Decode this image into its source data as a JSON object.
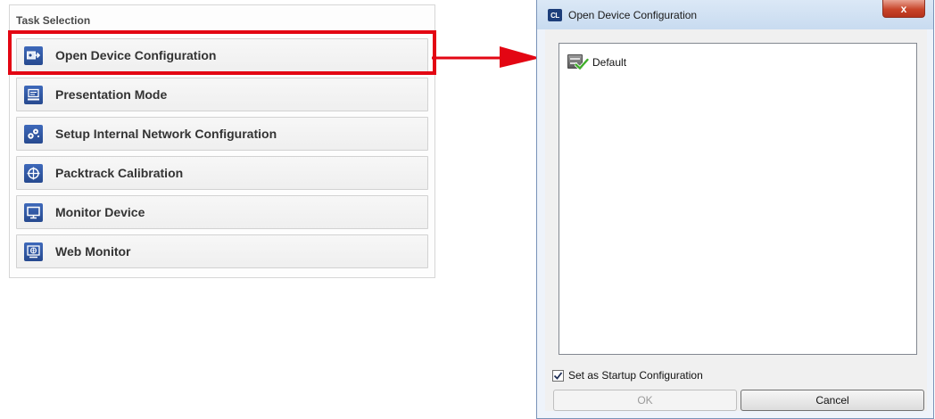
{
  "task_panel": {
    "title": "Task Selection",
    "items": [
      {
        "label": "Open Device Configuration",
        "icon": "open-configuration-icon"
      },
      {
        "label": "Presentation Mode",
        "icon": "presentation-mode-icon"
      },
      {
        "label": "Setup Internal Network Configuration",
        "icon": "network-configuration-icon"
      },
      {
        "label": "Packtrack Calibration",
        "icon": "calibration-crosshair-icon"
      },
      {
        "label": "Monitor Device",
        "icon": "monitor-icon"
      },
      {
        "label": "Web Monitor",
        "icon": "web-monitor-icon"
      }
    ],
    "highlighted_item": "Open Device Configuration",
    "highlight_color": "#e30613"
  },
  "dialog": {
    "app_icon_text": "CL",
    "title": "Open Device Configuration",
    "close_label": "x",
    "configurations": [
      {
        "name": "Default",
        "icon": "configuration-check-icon"
      }
    ],
    "startup_checkbox": {
      "label": "Set as Startup Configuration",
      "checked": true
    },
    "ok_label": "OK",
    "ok_enabled": false,
    "cancel_label": "Cancel"
  },
  "colors": {
    "accent_red": "#e30613",
    "tile_blue": "#26498f",
    "close_red": "#c8452a"
  }
}
